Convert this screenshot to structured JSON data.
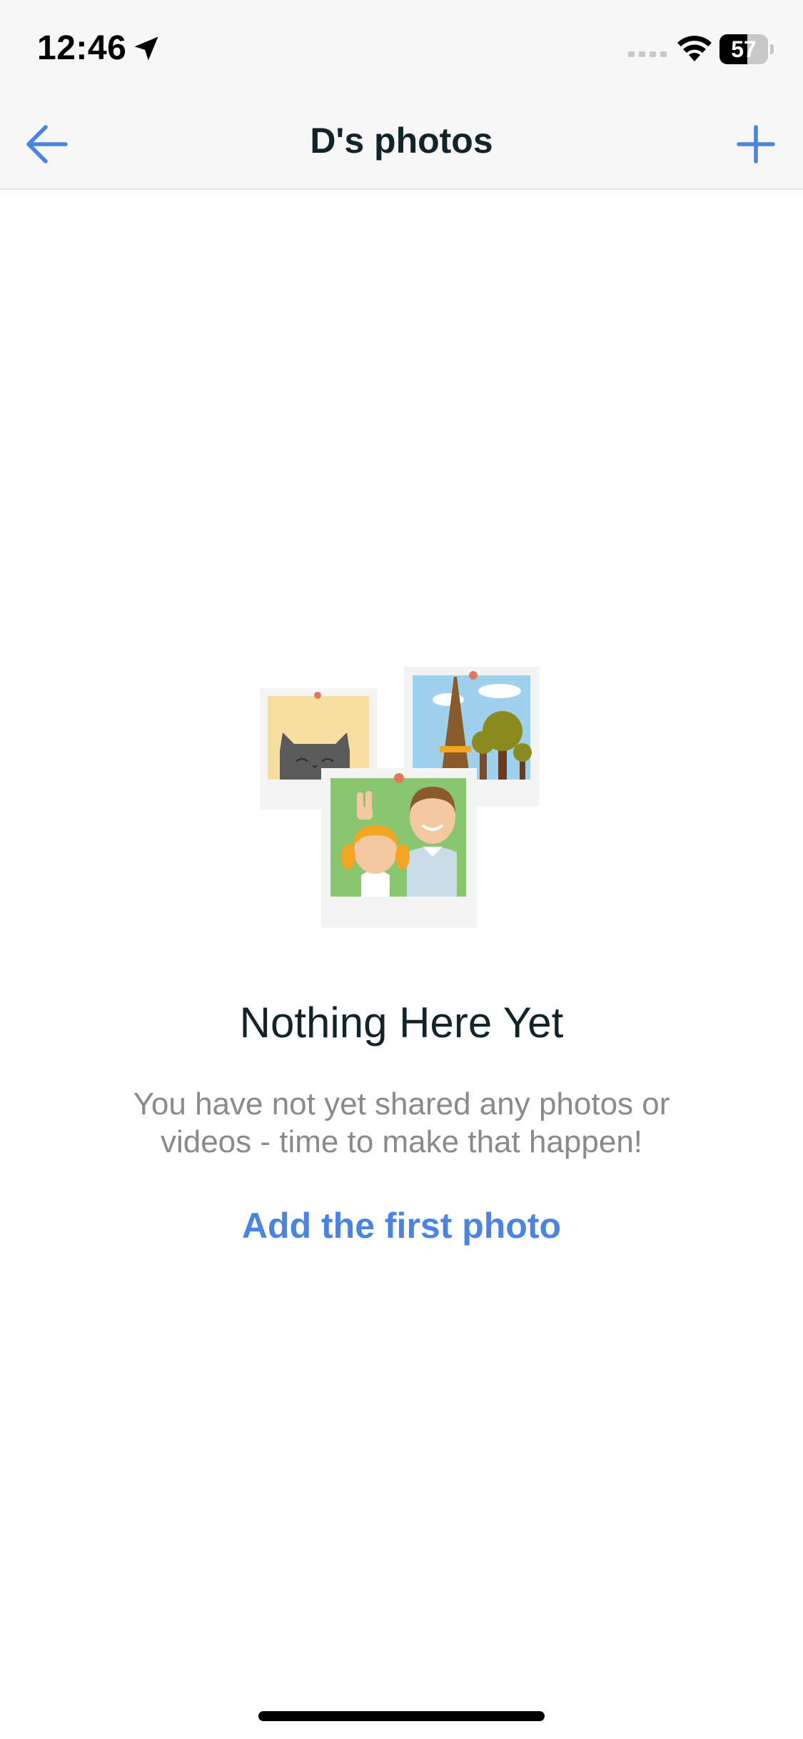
{
  "status_bar": {
    "time": "12:46",
    "battery_percent": 57,
    "battery_label": "57"
  },
  "nav": {
    "title": "D's photos"
  },
  "empty_state": {
    "title": "Nothing Here Yet",
    "description": "You have not yet shared any photos or videos - time to make that happen!",
    "action_label": "Add the first photo"
  },
  "colors": {
    "accent": "#4a84e0",
    "title_text": "#12242a",
    "body_text": "#8a8a8a",
    "bar_background": "#f7f7f7"
  }
}
